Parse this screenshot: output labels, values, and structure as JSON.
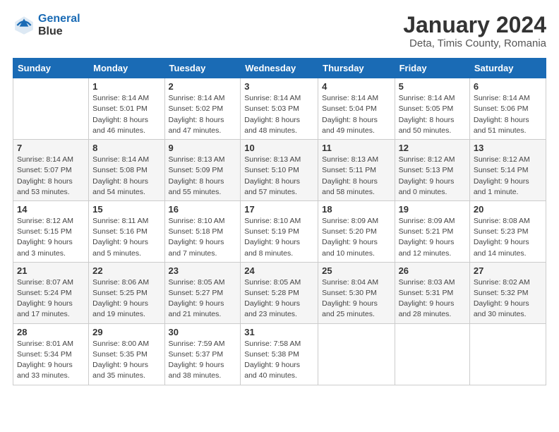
{
  "logo": {
    "line1": "General",
    "line2": "Blue"
  },
  "title": "January 2024",
  "subtitle": "Deta, Timis County, Romania",
  "weekdays": [
    "Sunday",
    "Monday",
    "Tuesday",
    "Wednesday",
    "Thursday",
    "Friday",
    "Saturday"
  ],
  "weeks": [
    [
      {
        "day": "",
        "info": ""
      },
      {
        "day": "1",
        "info": "Sunrise: 8:14 AM\nSunset: 5:01 PM\nDaylight: 8 hours\nand 46 minutes."
      },
      {
        "day": "2",
        "info": "Sunrise: 8:14 AM\nSunset: 5:02 PM\nDaylight: 8 hours\nand 47 minutes."
      },
      {
        "day": "3",
        "info": "Sunrise: 8:14 AM\nSunset: 5:03 PM\nDaylight: 8 hours\nand 48 minutes."
      },
      {
        "day": "4",
        "info": "Sunrise: 8:14 AM\nSunset: 5:04 PM\nDaylight: 8 hours\nand 49 minutes."
      },
      {
        "day": "5",
        "info": "Sunrise: 8:14 AM\nSunset: 5:05 PM\nDaylight: 8 hours\nand 50 minutes."
      },
      {
        "day": "6",
        "info": "Sunrise: 8:14 AM\nSunset: 5:06 PM\nDaylight: 8 hours\nand 51 minutes."
      }
    ],
    [
      {
        "day": "7",
        "info": ""
      },
      {
        "day": "8",
        "info": "Sunrise: 8:14 AM\nSunset: 5:08 PM\nDaylight: 8 hours\nand 54 minutes."
      },
      {
        "day": "9",
        "info": "Sunrise: 8:13 AM\nSunset: 5:09 PM\nDaylight: 8 hours\nand 55 minutes."
      },
      {
        "day": "10",
        "info": "Sunrise: 8:13 AM\nSunset: 5:10 PM\nDaylight: 8 hours\nand 57 minutes."
      },
      {
        "day": "11",
        "info": "Sunrise: 8:13 AM\nSunset: 5:11 PM\nDaylight: 8 hours\nand 58 minutes."
      },
      {
        "day": "12",
        "info": "Sunrise: 8:12 AM\nSunset: 5:13 PM\nDaylight: 9 hours\nand 0 minutes."
      },
      {
        "day": "13",
        "info": "Sunrise: 8:12 AM\nSunset: 5:14 PM\nDaylight: 9 hours\nand 1 minute."
      }
    ],
    [
      {
        "day": "14",
        "info": ""
      },
      {
        "day": "15",
        "info": "Sunrise: 8:11 AM\nSunset: 5:16 PM\nDaylight: 9 hours\nand 5 minutes."
      },
      {
        "day": "16",
        "info": "Sunrise: 8:10 AM\nSunset: 5:18 PM\nDaylight: 9 hours\nand 7 minutes."
      },
      {
        "day": "17",
        "info": "Sunrise: 8:10 AM\nSunset: 5:19 PM\nDaylight: 9 hours\nand 8 minutes."
      },
      {
        "day": "18",
        "info": "Sunrise: 8:09 AM\nSunset: 5:20 PM\nDaylight: 9 hours\nand 10 minutes."
      },
      {
        "day": "19",
        "info": "Sunrise: 8:09 AM\nSunset: 5:21 PM\nDaylight: 9 hours\nand 12 minutes."
      },
      {
        "day": "20",
        "info": "Sunrise: 8:08 AM\nSunset: 5:23 PM\nDaylight: 9 hours\nand 14 minutes."
      }
    ],
    [
      {
        "day": "21",
        "info": ""
      },
      {
        "day": "22",
        "info": "Sunrise: 8:06 AM\nSunset: 5:25 PM\nDaylight: 9 hours\nand 19 minutes."
      },
      {
        "day": "23",
        "info": "Sunrise: 8:05 AM\nSunset: 5:27 PM\nDaylight: 9 hours\nand 21 minutes."
      },
      {
        "day": "24",
        "info": "Sunrise: 8:05 AM\nSunset: 5:28 PM\nDaylight: 9 hours\nand 23 minutes."
      },
      {
        "day": "25",
        "info": "Sunrise: 8:04 AM\nSunset: 5:30 PM\nDaylight: 9 hours\nand 25 minutes."
      },
      {
        "day": "26",
        "info": "Sunrise: 8:03 AM\nSunset: 5:31 PM\nDaylight: 9 hours\nand 28 minutes."
      },
      {
        "day": "27",
        "info": "Sunrise: 8:02 AM\nSunset: 5:32 PM\nDaylight: 9 hours\nand 30 minutes."
      }
    ],
    [
      {
        "day": "28",
        "info": ""
      },
      {
        "day": "29",
        "info": "Sunrise: 8:00 AM\nSunset: 5:35 PM\nDaylight: 9 hours\nand 35 minutes."
      },
      {
        "day": "30",
        "info": "Sunrise: 7:59 AM\nSunset: 5:37 PM\nDaylight: 9 hours\nand 38 minutes."
      },
      {
        "day": "31",
        "info": "Sunrise: 7:58 AM\nSunset: 5:38 PM\nDaylight: 9 hours\nand 40 minutes."
      },
      {
        "day": "",
        "info": ""
      },
      {
        "day": "",
        "info": ""
      },
      {
        "day": "",
        "info": ""
      }
    ]
  ],
  "week1_sunday": "Sunrise: 8:14 AM\nSunset: 5:07 PM\nDaylight: 8 hours\nand 53 minutes.",
  "week2_sunday": "Sunrise: 8:12 AM\nSunset: 5:15 PM\nDaylight: 9 hours\nand 3 minutes.",
  "week3_sunday": "Sunrise: 8:07 AM\nSunset: 5:24 PM\nDaylight: 9 hours\nand 17 minutes.",
  "week4_sunday": "Sunrise: 8:01 AM\nSunset: 5:34 PM\nDaylight: 9 hours\nand 33 minutes."
}
